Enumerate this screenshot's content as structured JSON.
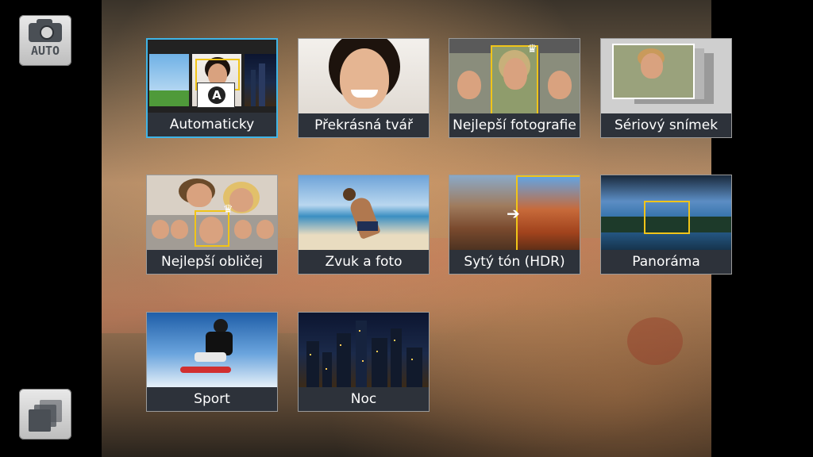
{
  "side": {
    "auto_button_label": "AUTO"
  },
  "modes": [
    {
      "label": "Automaticky",
      "selected": true
    },
    {
      "label": "Překrásná tvář",
      "selected": false
    },
    {
      "label": "Nejlepší fotografie",
      "selected": false
    },
    {
      "label": "Sériový snímek",
      "selected": false
    },
    {
      "label": "Nejlepší obličej",
      "selected": false
    },
    {
      "label": "Zvuk a foto",
      "selected": false
    },
    {
      "label": "Sytý tón (HDR)",
      "selected": false
    },
    {
      "label": "Panoráma",
      "selected": false
    },
    {
      "label": "Sport",
      "selected": false
    },
    {
      "label": "Noc",
      "selected": false
    }
  ],
  "colors": {
    "selected_border": "#3fb4e6",
    "label_bg": "#2e343c",
    "highlight_frame": "#f0c419"
  }
}
